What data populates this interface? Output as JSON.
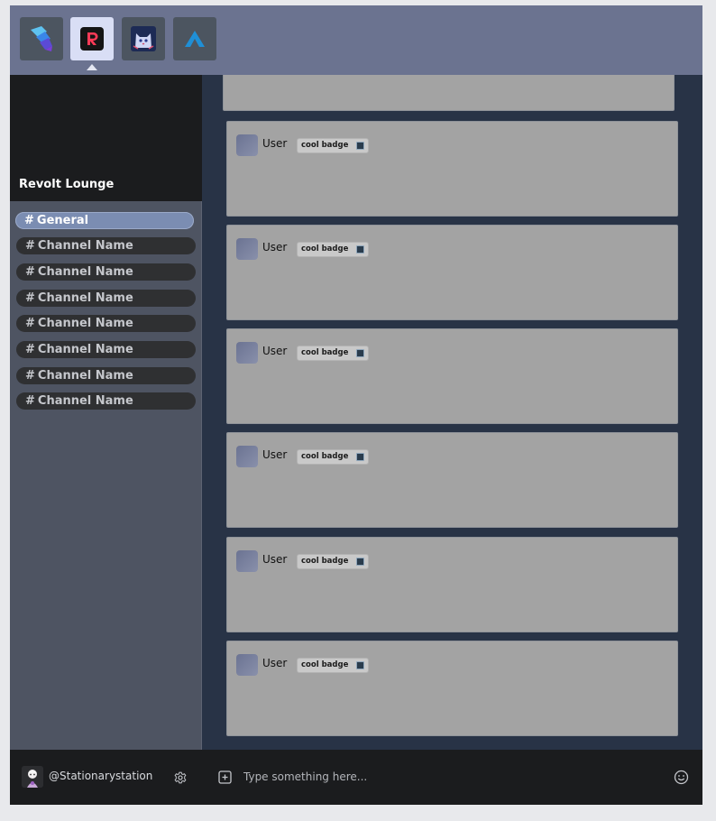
{
  "servers": [
    {
      "name": "brush-server-icon",
      "active": false
    },
    {
      "name": "revolt-server-icon",
      "active": true
    },
    {
      "name": "cat-server-icon",
      "active": false
    },
    {
      "name": "arrow-server-icon",
      "active": false
    }
  ],
  "sidebar": {
    "server_name": "Revolt Lounge",
    "channels": [
      {
        "hash": "#",
        "label": "General",
        "active": true
      },
      {
        "hash": "#",
        "label": "Channel Name",
        "active": false
      },
      {
        "hash": "#",
        "label": "Channel Name",
        "active": false
      },
      {
        "hash": "#",
        "label": "Channel Name",
        "active": false
      },
      {
        "hash": "#",
        "label": "Channel Name",
        "active": false
      },
      {
        "hash": "#",
        "label": "Channel Name",
        "active": false
      },
      {
        "hash": "#",
        "label": "Channel Name",
        "active": false
      },
      {
        "hash": "#",
        "label": "Channel Name",
        "active": false
      }
    ],
    "username": "@Stationarystation"
  },
  "messages": [
    {
      "user": "User",
      "badge": "cool badge"
    },
    {
      "user": "User",
      "badge": "cool badge"
    },
    {
      "user": "User",
      "badge": "cool badge"
    },
    {
      "user": "User",
      "badge": "cool badge"
    },
    {
      "user": "User",
      "badge": "cool badge"
    },
    {
      "user": "User",
      "badge": "cool badge"
    }
  ],
  "composer": {
    "placeholder": "Type something here..."
  },
  "colors": {
    "server_bar": "#6b7390",
    "active_channel": "#7b8db2",
    "message_bg": "#a3a3a3",
    "chat_bg": "#283346"
  }
}
